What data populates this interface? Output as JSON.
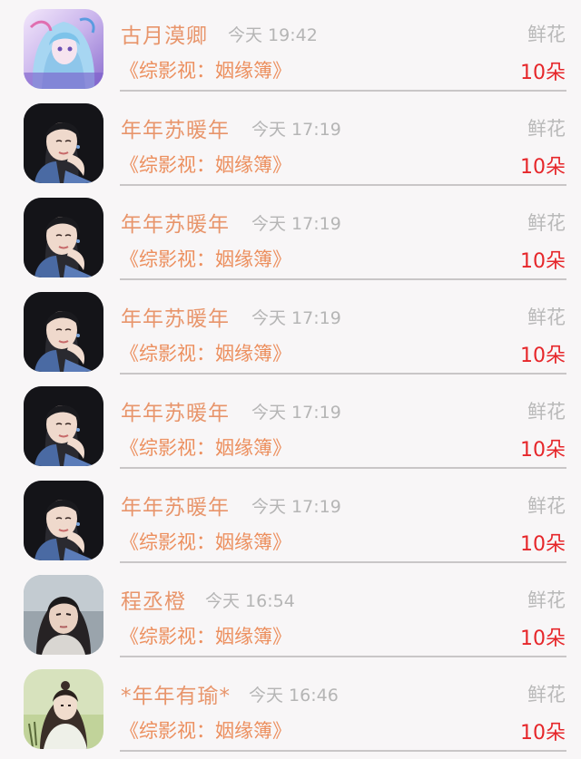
{
  "records": [
    {
      "name": "古月漠卿",
      "time": "今天 19:42",
      "gift": "鲜花",
      "book": "《综影视：姻缘簿》",
      "amount": "10朵",
      "avatar": "anime-avatar"
    },
    {
      "name": "年年苏暖年",
      "time": "今天 17:19",
      "gift": "鲜花",
      "book": "《综影视：姻缘簿》",
      "amount": "10朵",
      "avatar": "actress-avatar"
    },
    {
      "name": "年年苏暖年",
      "time": "今天 17:19",
      "gift": "鲜花",
      "book": "《综影视：姻缘簿》",
      "amount": "10朵",
      "avatar": "actress-avatar"
    },
    {
      "name": "年年苏暖年",
      "time": "今天 17:19",
      "gift": "鲜花",
      "book": "《综影视：姻缘簿》",
      "amount": "10朵",
      "avatar": "actress-avatar"
    },
    {
      "name": "年年苏暖年",
      "time": "今天 17:19",
      "gift": "鲜花",
      "book": "《综影视：姻缘簿》",
      "amount": "10朵",
      "avatar": "actress-avatar"
    },
    {
      "name": "年年苏暖年",
      "time": "今天 17:19",
      "gift": "鲜花",
      "book": "《综影视：姻缘簿》",
      "amount": "10朵",
      "avatar": "actress-avatar"
    },
    {
      "name": "程丞橙",
      "time": "今天 16:54",
      "gift": "鲜花",
      "book": "《综影视：姻缘簿》",
      "amount": "10朵",
      "avatar": "actor-avatar"
    },
    {
      "name": "*年年有瑜*",
      "time": "今天 16:46",
      "gift": "鲜花",
      "book": "《综影视：姻缘簿》",
      "amount": "10朵",
      "avatar": "costume-actor-avatar"
    }
  ],
  "colors": {
    "name": "#e8956b",
    "time": "#b5b5b5",
    "gift": "#b9b9b9",
    "book": "#ec8f5e",
    "amount": "#e6262a",
    "divider": "#c9c6c7"
  }
}
